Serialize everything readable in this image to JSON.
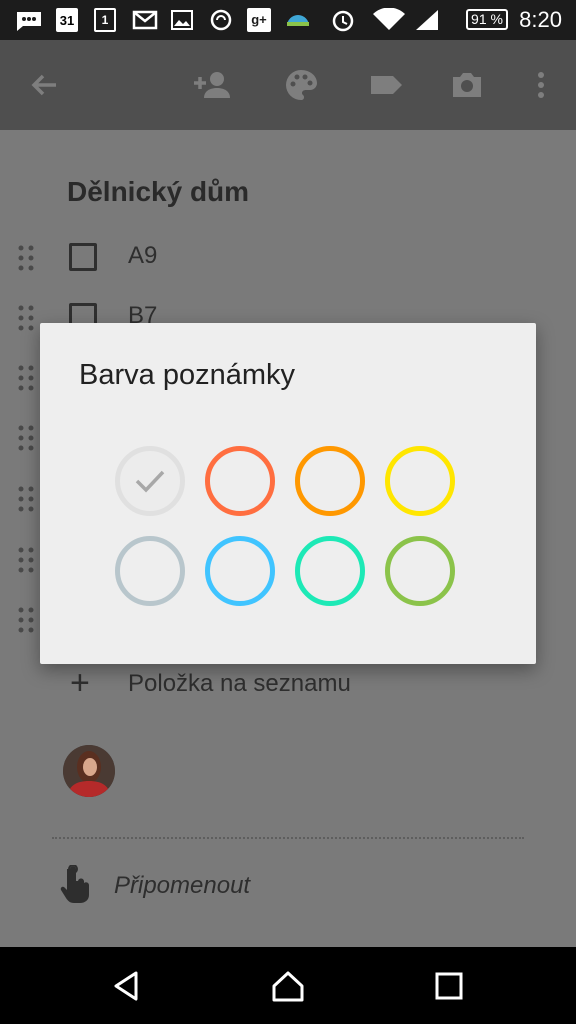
{
  "status_bar": {
    "time": "8:20",
    "battery": "91 %",
    "icons": [
      "messages-icon",
      "calendar-31-icon",
      "calendar-1-icon",
      "gmail-icon",
      "gallery-icon",
      "sync-icon",
      "google-plus-icon",
      "weather-icon",
      "alarm-icon",
      "wifi-icon",
      "signal-icon"
    ],
    "calendar_day_a": "31",
    "calendar_day_b": "1"
  },
  "toolbar": {
    "back_icon": "back-arrow-icon",
    "actions": [
      "add-person-icon",
      "palette-icon",
      "label-icon",
      "camera-icon",
      "more-vert-icon"
    ]
  },
  "note": {
    "title": "Dělnický dům",
    "items": [
      {
        "text": "A9",
        "checked": false
      },
      {
        "text": "B7",
        "checked": false
      }
    ],
    "add_item_label": "Položka na seznamu",
    "reminder_label": "Připomenout"
  },
  "dialog": {
    "title": "Barva poznámky",
    "swatches": [
      {
        "name": "white",
        "color": "#e0e0e0",
        "selected": true
      },
      {
        "name": "red",
        "color": "#ff6e40"
      },
      {
        "name": "orange",
        "color": "#ff9800"
      },
      {
        "name": "yellow",
        "color": "#ffe600"
      },
      {
        "name": "gray",
        "color": "#b8c6cc"
      },
      {
        "name": "blue",
        "color": "#40c4ff"
      },
      {
        "name": "teal",
        "color": "#1de9b6"
      },
      {
        "name": "green",
        "color": "#8bc34a"
      }
    ]
  },
  "nav_bar": {
    "buttons": [
      "back-triangle-icon",
      "home-icon",
      "recents-icon"
    ]
  }
}
